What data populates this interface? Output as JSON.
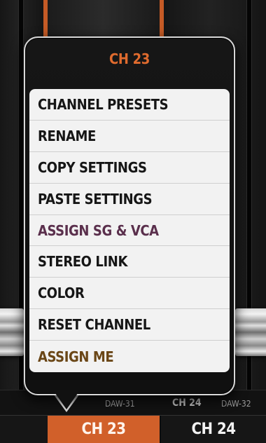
{
  "popup": {
    "title": "CH 23",
    "items": [
      {
        "label": "CHANNEL PRESETS"
      },
      {
        "label": "RENAME"
      },
      {
        "label": "COPY SETTINGS"
      },
      {
        "label": "PASTE SETTINGS"
      },
      {
        "label": "ASSIGN SG & VCA"
      },
      {
        "label": "STEREO LINK"
      },
      {
        "label": "COLOR"
      },
      {
        "label": "RESET CHANNEL"
      },
      {
        "label": "ASSIGN ME"
      }
    ]
  },
  "channel_labels": {
    "left_tag": "DAW-31",
    "right_name": "CH 24",
    "right_tag": "DAW-32"
  },
  "bottom_tabs": {
    "active": "CH 23",
    "next": "CH 24"
  },
  "colors": {
    "accent_orange": "#d1602a",
    "title_orange": "#e06b2e",
    "assign_sg_color": "#5a2f4c",
    "assign_me_color": "#6a4616"
  }
}
